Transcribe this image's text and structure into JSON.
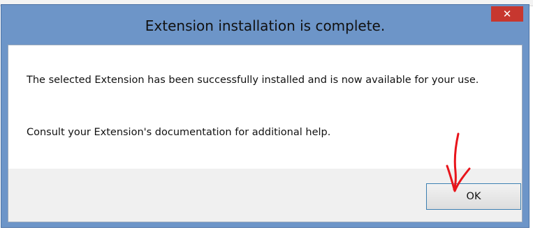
{
  "dialog": {
    "title": "Extension installation is complete.",
    "close_icon": "close-icon",
    "close_glyph": "✕",
    "message_line1": "The selected Extension has been successfully installed and is now available for your use.",
    "message_line2": "Consult your Extension's documentation for additional help.",
    "ok_label": "OK"
  },
  "colors": {
    "titlebar": "#6d95c8",
    "close_button": "#c7372f",
    "annotation_arrow": "#e8141b"
  }
}
